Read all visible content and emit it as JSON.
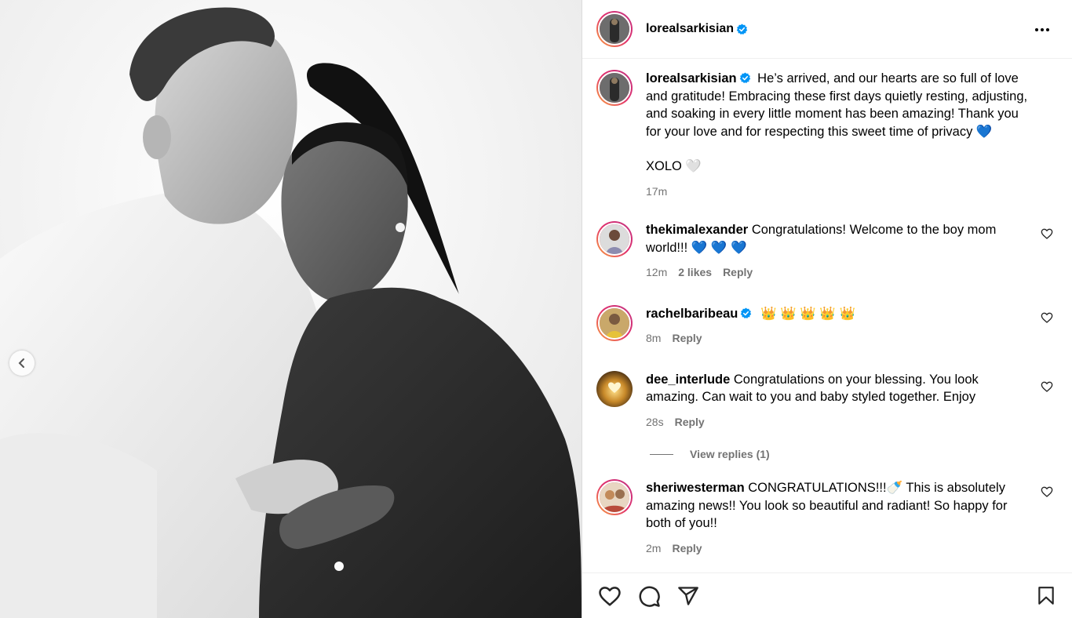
{
  "post": {
    "author": "lorealsarkisian",
    "verified": true,
    "caption": "He’s arrived, and our hearts are so full of love and gratitude! Embracing these first days quietly resting, adjusting, and soaking in every little moment has been amazing! Thank you for your love and for respecting this sweet time of privacy 💙",
    "caption_signoff": "XOLO 🤍",
    "time": "17m"
  },
  "comments": [
    {
      "username": "thekimalexander",
      "verified": false,
      "text": "Congratulations! Welcome to the boy mom world!!! 💙 💙 💙",
      "time": "12m",
      "likes": "2 likes",
      "reply": "Reply"
    },
    {
      "username": "rachelbaribeau",
      "verified": true,
      "text": "👑 👑 👑 👑 👑",
      "time": "8m",
      "reply": "Reply"
    },
    {
      "username": "dee_interlude",
      "verified": false,
      "text": "Congratulations on your blessing. You look amazing. Can wait to you and baby styled together. Enjoy",
      "time": "28s",
      "reply": "Reply",
      "view_replies": "View replies (1)"
    },
    {
      "username": "sheriwesterman",
      "verified": false,
      "text": "CONGRATULATIONS!!!🍼 This is absolutely amazing news!! You look so beautiful and radiant! So happy for both of you!!",
      "time": "2m",
      "reply": "Reply"
    }
  ],
  "icons": {
    "more": "more-options-icon",
    "prev": "chevron-left-icon",
    "like": "heart-icon",
    "comment": "comment-icon",
    "share": "send-icon",
    "save": "bookmark-icon"
  },
  "colors": {
    "verified": "#0095f6",
    "meta": "#737373",
    "border": "#dbdbdb"
  }
}
